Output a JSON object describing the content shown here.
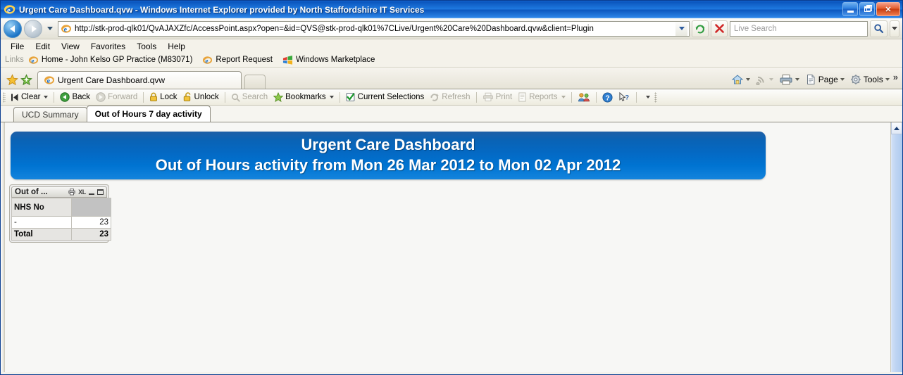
{
  "window": {
    "title": "Urgent Care Dashboard.qvw - Windows Internet Explorer provided by North Staffordshire IT Services",
    "app_icon": "internet-explorer-icon",
    "minimize_label": "Minimize",
    "restore_label": "Restore",
    "close_label": "Close"
  },
  "navbar": {
    "back_label": "Back",
    "forward_label": "Forward",
    "recent_label": "Recent Pages",
    "address_value": "http://stk-prod-qlk01/QvAJAXZfc/AccessPoint.aspx?open=&id=QVS@stk-prod-qlk01%7CLive/Urgent%20Care%20Dashboard.qvw&client=Plugin",
    "address_placeholder": "Address",
    "refresh_label": "Refresh",
    "stop_label": "Stop",
    "search_placeholder": "Live Search",
    "search_value": "",
    "search_go_label": "Search",
    "search_dropdown_label": "Search Options"
  },
  "menubar": {
    "items": [
      {
        "label": "File"
      },
      {
        "label": "Edit"
      },
      {
        "label": "View"
      },
      {
        "label": "Favorites"
      },
      {
        "label": "Tools"
      },
      {
        "label": "Help"
      }
    ]
  },
  "linksbar": {
    "label": "Links",
    "items": [
      {
        "label": "Home - John Kelso GP Practice (M83071)",
        "icon": "internet-explorer-icon"
      },
      {
        "label": "Report Request",
        "icon": "internet-explorer-icon"
      },
      {
        "label": "Windows Marketplace",
        "icon": "windows-marketplace-icon"
      }
    ]
  },
  "browser_tabs": {
    "favorites_icon": "star-icon",
    "add_favorites_icon": "add-to-favorites-icon",
    "tabs": [
      {
        "label": "Urgent Care Dashboard.qvw",
        "icon": "internet-explorer-icon",
        "active": true
      }
    ],
    "new_tab_label": "New Tab",
    "commands": [
      {
        "label": "",
        "icon": "home-icon",
        "has_dropdown": true
      },
      {
        "label": "",
        "icon": "rss-feed-icon",
        "has_dropdown": true,
        "disabled": true
      },
      {
        "label": "",
        "icon": "print-icon",
        "has_dropdown": true
      },
      {
        "label": "Page",
        "icon": "page-icon",
        "has_dropdown": true
      },
      {
        "label": "Tools",
        "icon": "gear-icon",
        "has_dropdown": true
      }
    ],
    "overflow_label": "»"
  },
  "qlikview_toolbar": {
    "items": [
      {
        "label": "Clear",
        "icon": "clear-icon",
        "dropdown": true,
        "disabled": false
      },
      {
        "sep": true
      },
      {
        "label": "Back",
        "icon": "back-icon",
        "dropdown": false,
        "disabled": false
      },
      {
        "label": "Forward",
        "icon": "forward-icon",
        "dropdown": false,
        "disabled": true
      },
      {
        "sep": true
      },
      {
        "label": "Lock",
        "icon": "lock-icon",
        "dropdown": false,
        "disabled": false
      },
      {
        "label": "Unlock",
        "icon": "unlock-icon",
        "dropdown": false,
        "disabled": false
      },
      {
        "sep": true
      },
      {
        "label": "Search",
        "icon": "search-icon",
        "dropdown": false,
        "disabled": true
      },
      {
        "label": "Bookmarks",
        "icon": "bookmark-star-icon",
        "dropdown": true,
        "disabled": false
      },
      {
        "sep": true
      },
      {
        "label": "Current Selections",
        "icon": "current-selections-icon",
        "dropdown": false,
        "disabled": false
      },
      {
        "label": "Refresh",
        "icon": "refresh-icon",
        "dropdown": false,
        "disabled": true
      },
      {
        "sep": true
      },
      {
        "label": "Print",
        "icon": "print-icon",
        "dropdown": false,
        "disabled": true
      },
      {
        "label": "Reports",
        "icon": "reports-icon",
        "dropdown": true,
        "disabled": true
      },
      {
        "sep": true
      },
      {
        "label": "",
        "icon": "collaboration-users-icon",
        "dropdown": false,
        "disabled": false
      },
      {
        "sep": true
      },
      {
        "label": "",
        "icon": "help-icon",
        "dropdown": false,
        "disabled": false
      },
      {
        "label": "",
        "icon": "context-help-pointer-icon",
        "dropdown": false,
        "disabled": false
      },
      {
        "sep": true
      },
      {
        "label": "Menu",
        "icon": "",
        "dropdown": true,
        "disabled": false
      }
    ]
  },
  "sheet_tabs": [
    {
      "label": "UCD Summary",
      "active": false
    },
    {
      "label": "Out of Hours 7 day activity",
      "active": true
    }
  ],
  "banner": {
    "line1": "Urgent Care Dashboard",
    "line2": "Out of Hours activity from Mon 26 Mar 2012 to Mon 02 Apr 2012",
    "background_color": "#0469c4",
    "text_color": "#ffffff"
  },
  "table_object": {
    "caption": "Out of ...",
    "caption_icons": [
      {
        "name": "print-object-icon"
      },
      {
        "name": "export-to-excel-icon",
        "label": "XL"
      },
      {
        "name": "minimize-object-icon"
      },
      {
        "name": "maximize-object-icon"
      }
    ],
    "chart_data": {
      "type": "table",
      "title": "Out of ...",
      "columns": [
        "NHS No",
        ""
      ],
      "rows": [
        {
          "label": "-",
          "value": "23"
        }
      ],
      "total_label": "Total",
      "total_value": "23"
    }
  },
  "scrollbar": {
    "up_arrow_label": "Scroll Up",
    "orientation": "vertical"
  }
}
